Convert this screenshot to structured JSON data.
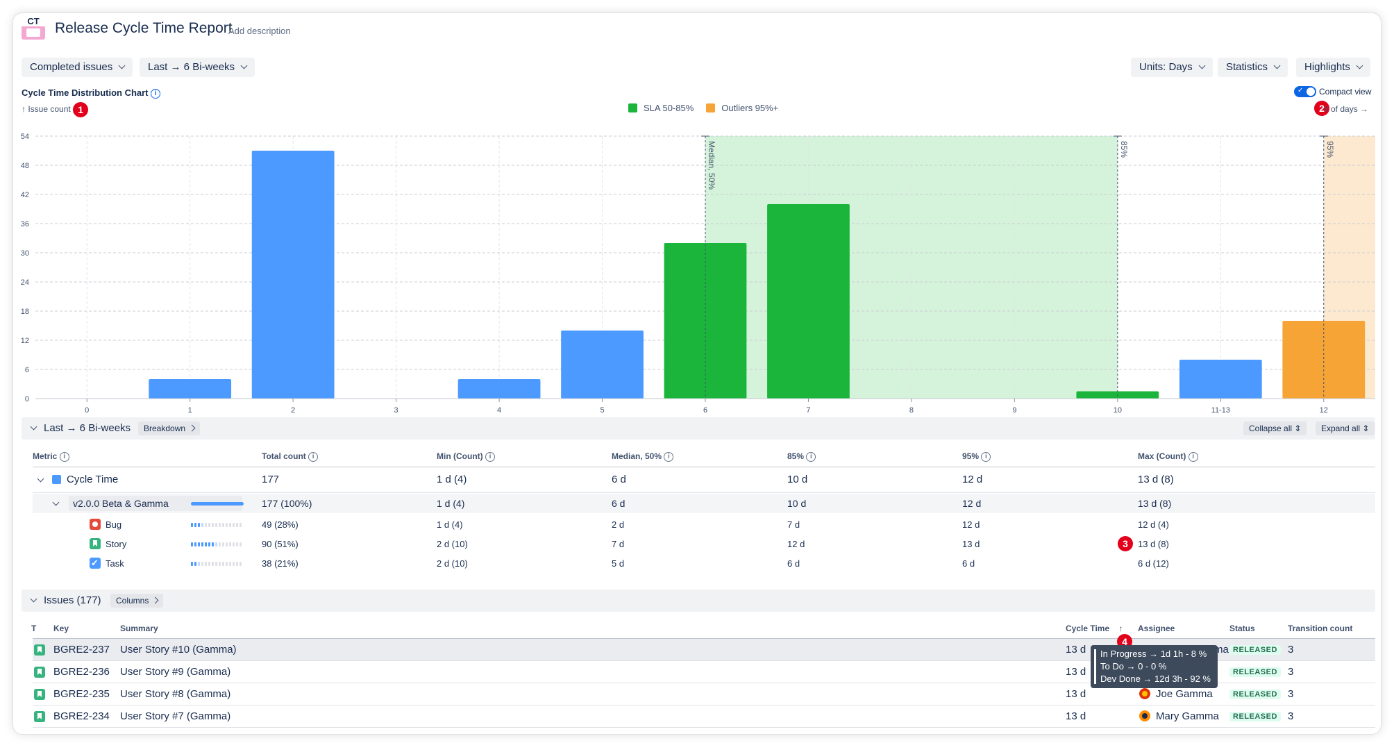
{
  "app": {
    "logo_top": "CT",
    "title": "Release Cycle Time Report",
    "add_description": "Add description"
  },
  "filters": {
    "left": [
      "Completed issues",
      "Last → 6 Bi-weeks"
    ],
    "right": [
      "Units: Days",
      "Statistics",
      "Highlights"
    ]
  },
  "chart_header": {
    "title": "Cycle Time Distribution Chart",
    "y_label": "↑ Issue count",
    "x_label": "# of days →",
    "compact_view": "Compact view",
    "compact_view_on": true
  },
  "legend": [
    {
      "label": "SLA 50-85%",
      "color": "#1bb53b"
    },
    {
      "label": "Outliers 95%+",
      "color": "#f7a436"
    }
  ],
  "badges": [
    "1",
    "2",
    "3",
    "4"
  ],
  "chart_data": {
    "type": "bar",
    "categories": [
      "0",
      "1",
      "2",
      "3",
      "4",
      "5",
      "6",
      "7",
      "8",
      "9",
      "10",
      "11-13",
      "12"
    ],
    "values": [
      0,
      4,
      51,
      0,
      4,
      14,
      32,
      40,
      0,
      0,
      1.5,
      8,
      16
    ],
    "colors": [
      "#4c9aff",
      "#4c9aff",
      "#4c9aff",
      "#4c9aff",
      "#4c9aff",
      "#4c9aff",
      "#1bb53b",
      "#1bb53b",
      "#1bb53b",
      "#1bb53b",
      "#1bb53b",
      "#4c9aff",
      "#f7a436"
    ],
    "ylim": [
      0,
      54
    ],
    "yticks": [
      0,
      6,
      12,
      18,
      24,
      30,
      36,
      42,
      48,
      54
    ],
    "ylabel": "Issue count",
    "xlabel": "# of days",
    "markers": [
      {
        "label": "Median, 50%",
        "category": "6"
      },
      {
        "label": "85%",
        "category": "10"
      },
      {
        "label": "95%",
        "category": "12"
      }
    ],
    "sla_band": {
      "from": "6",
      "to": "10"
    },
    "outlier_band": {
      "from": "12"
    }
  },
  "breakdown": {
    "title": "Last → 6 Bi-weeks",
    "breakdown_btn": "Breakdown",
    "collapse_all": "Collapse all",
    "expand_all": "Expand all"
  },
  "stats_table": {
    "headers": [
      "Metric",
      "Total count",
      "Min (Count)",
      "Median, 50%",
      "85%",
      "95%",
      "Max (Count)"
    ],
    "rows": [
      {
        "name": "Cycle Time",
        "cells": [
          "177",
          "1 d (4)",
          "6 d",
          "10 d",
          "12 d",
          "13 d (8)"
        ]
      },
      {
        "name": "v2.0.0 Beta & Gamma",
        "cells": [
          "177 (100%)",
          "1 d (4)",
          "6 d",
          "10 d",
          "12 d",
          "13 d (8)"
        ]
      },
      {
        "name": "Bug",
        "cells": [
          "49 (28%)",
          "1 d (4)",
          "2 d",
          "7 d",
          "12 d",
          "12 d (4)"
        ]
      },
      {
        "name": "Story",
        "cells": [
          "90 (51%)",
          "2 d (10)",
          "7 d",
          "12 d",
          "13 d",
          "13 d (8)"
        ]
      },
      {
        "name": "Task",
        "cells": [
          "38 (21%)",
          "2 d (10)",
          "5 d",
          "6 d",
          "6 d",
          "6 d (12)"
        ]
      }
    ]
  },
  "issues": {
    "title": "Issues (177)",
    "columns_btn": "Columns",
    "headers": [
      "T",
      "Key",
      "Summary",
      "Cycle Time",
      "↑",
      "Assignee",
      "Status",
      "Transition count"
    ],
    "rows": [
      {
        "key": "BGRE2-237",
        "summary": "User Story #10 (Gamma)",
        "cycle": "13 d",
        "assignee": "ma",
        "status": "RELEASED",
        "transitions": "3"
      },
      {
        "key": "BGRE2-236",
        "summary": "User Story #9 (Gamma)",
        "cycle": "13 d",
        "assignee": "",
        "status": "RELEASED",
        "transitions": "3"
      },
      {
        "key": "BGRE2-235",
        "summary": "User Story #8 (Gamma)",
        "cycle": "13 d",
        "assignee": "Joe Gamma",
        "status": "RELEASED",
        "transitions": "3"
      },
      {
        "key": "BGRE2-234",
        "summary": "User Story #7 (Gamma)",
        "cycle": "13 d",
        "assignee": "Mary Gamma",
        "status": "RELEASED",
        "transitions": "3"
      }
    ]
  },
  "tooltip": [
    "In Progress → 1d 1h - 8 %",
    "To Do → 0 - 0 %",
    "Dev Done → 12d 3h - 92 %"
  ]
}
